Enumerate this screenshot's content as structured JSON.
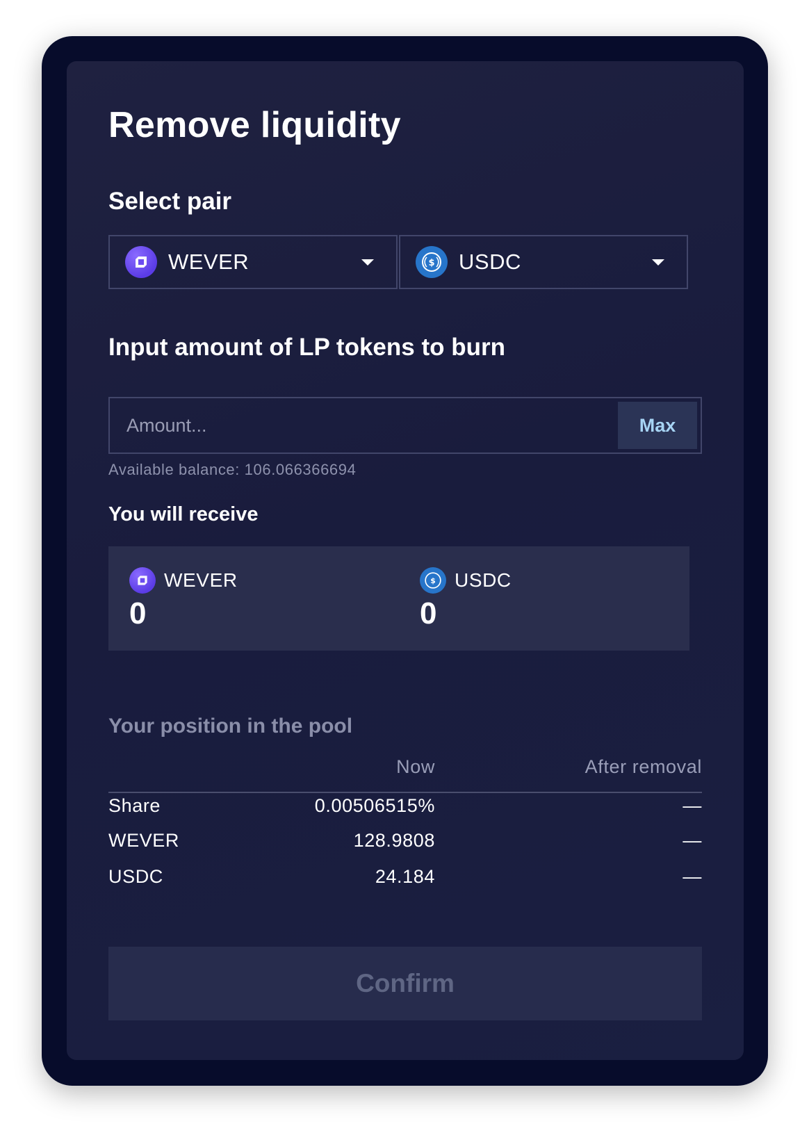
{
  "modal": {
    "title": "Remove liquidity",
    "select_pair_label": "Select pair",
    "pair": [
      {
        "symbol": "WEVER",
        "icon": "wever-icon"
      },
      {
        "symbol": "USDC",
        "icon": "usdc-icon"
      }
    ],
    "burn_label": "Input amount of LP tokens to burn",
    "amount_placeholder": "Amount...",
    "max_label": "Max",
    "available_balance": "Available balance: 106.066366694",
    "receive_label": "You will receive",
    "receive": [
      {
        "symbol": "WEVER",
        "amount": "0"
      },
      {
        "symbol": "USDC",
        "amount": "0"
      }
    ],
    "position_label": "Your position in the pool",
    "table": {
      "columns": [
        "Now",
        "After removal"
      ],
      "rows": [
        {
          "label": "Share",
          "now": "0.00506515%",
          "after": "—"
        },
        {
          "label": "WEVER",
          "now": "128.9808",
          "after": "—"
        },
        {
          "label": "USDC",
          "now": "24.184",
          "after": "—"
        }
      ]
    },
    "confirm_label": "Confirm"
  },
  "colors": {
    "frame": "#070c2b",
    "panel": "#1b1e3f",
    "accent_max": "#a7d4f4",
    "wever_icon": "#5b3ce6",
    "usdc_icon": "#2775ca",
    "confirm_disabled_text": "#5f6684"
  }
}
